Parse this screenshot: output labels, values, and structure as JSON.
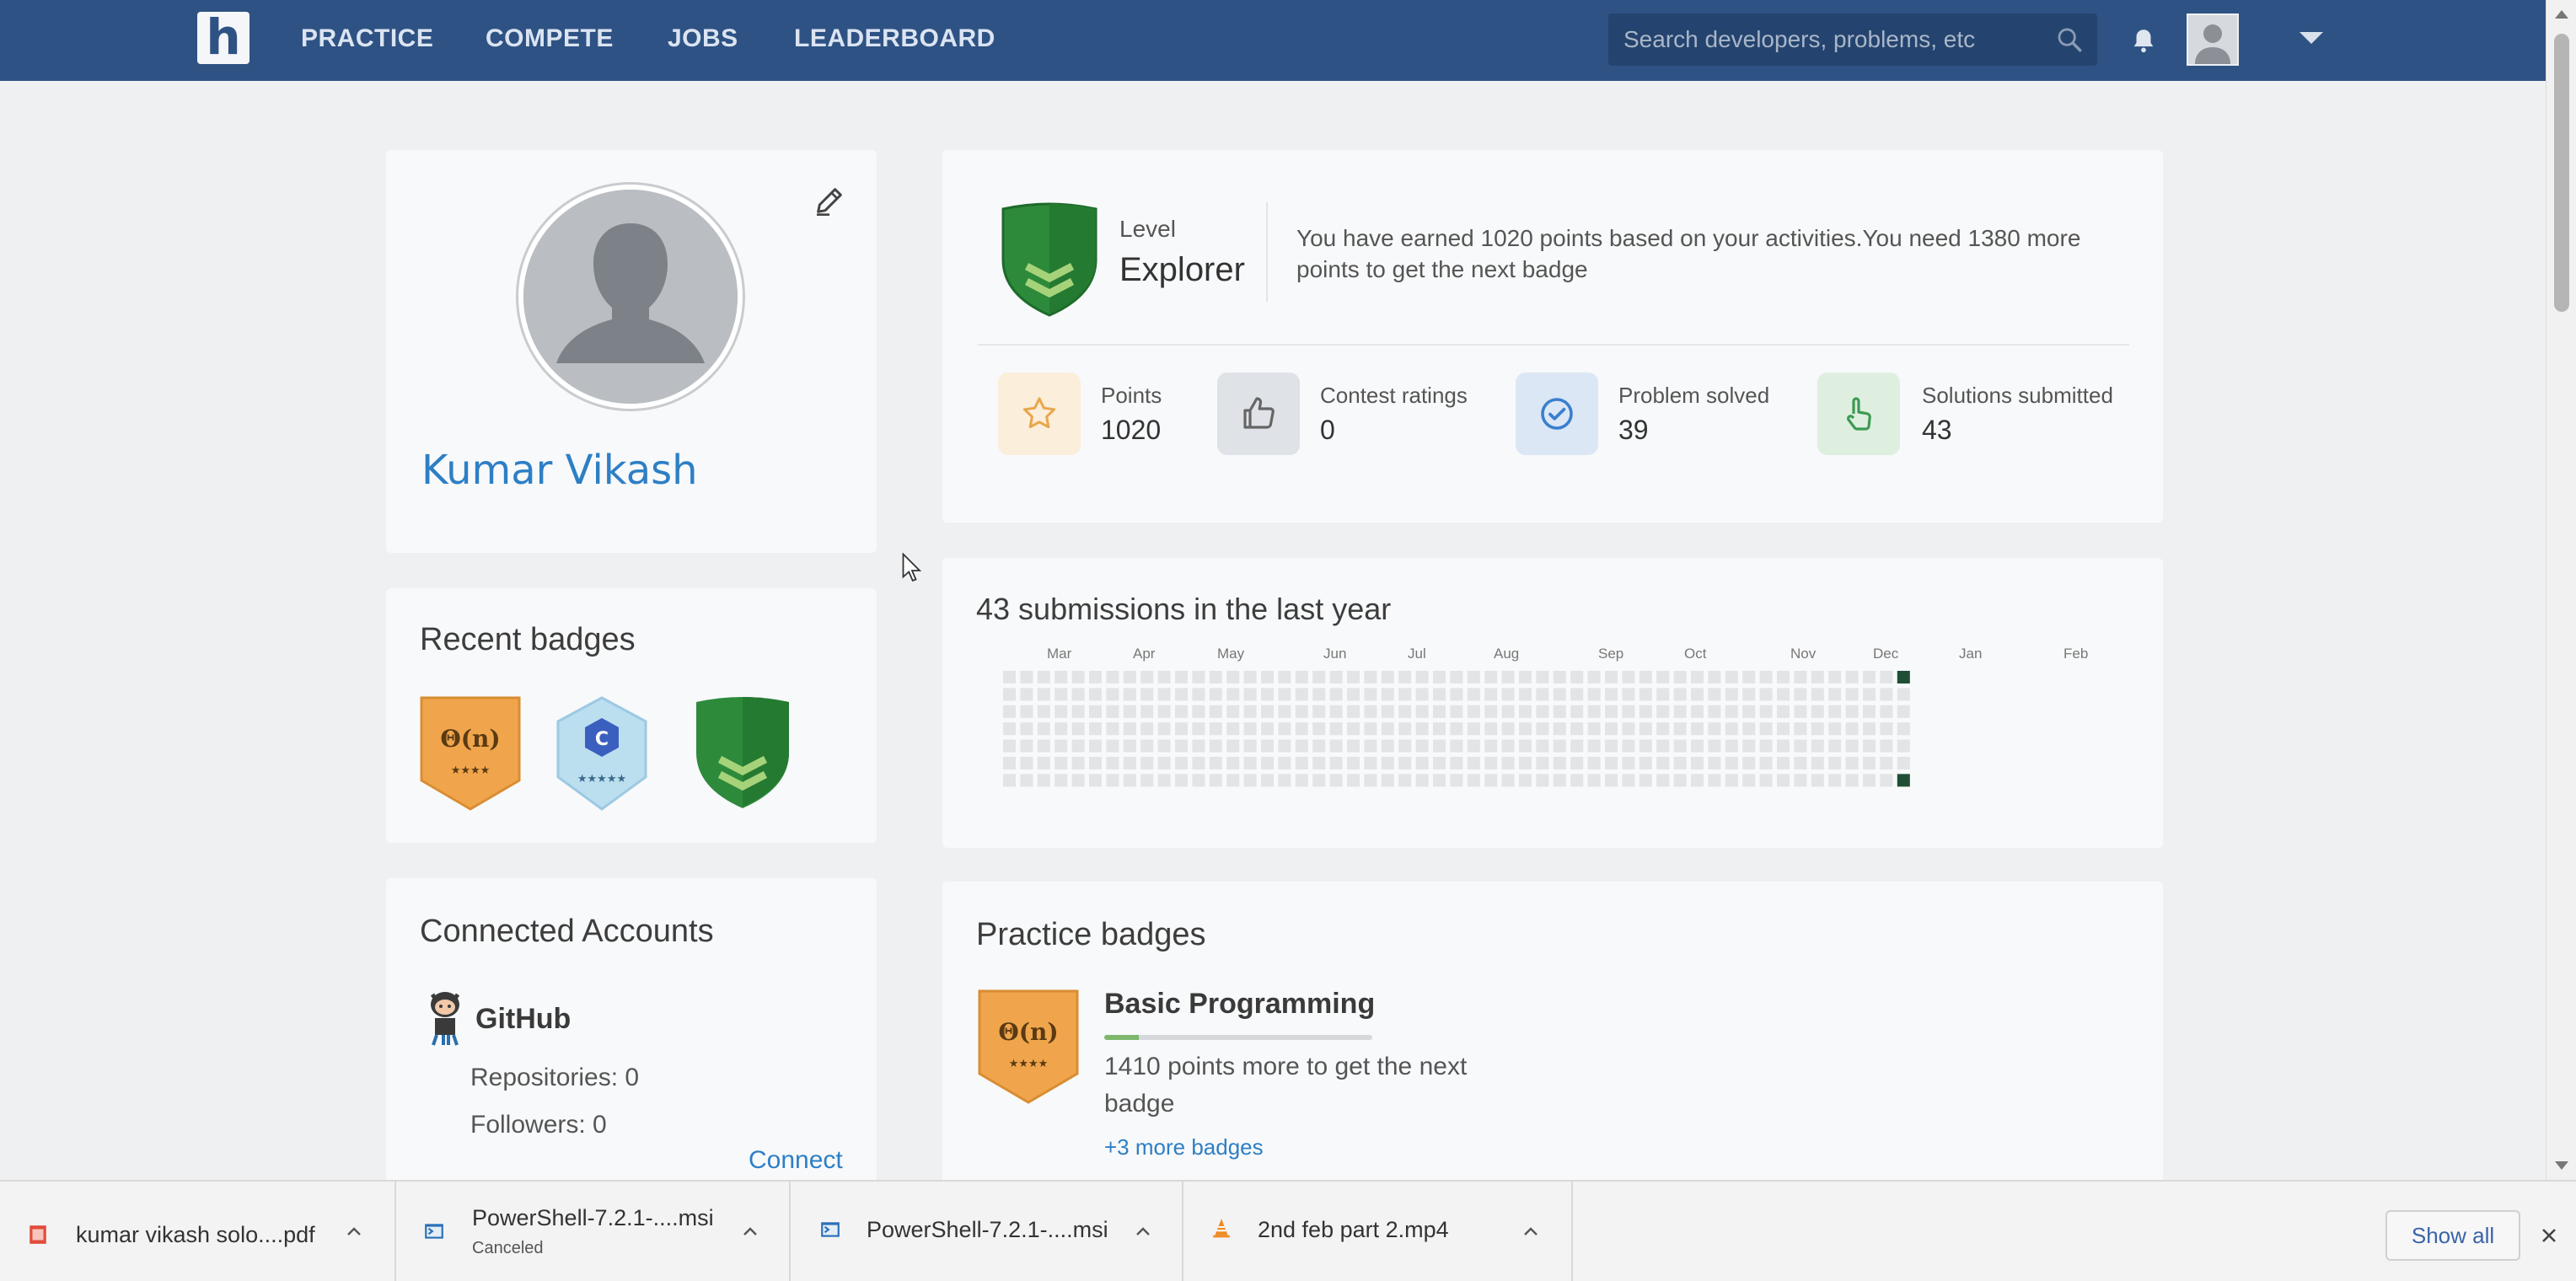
{
  "nav": {
    "logo": "h",
    "links": [
      "PRACTICE",
      "COMPETE",
      "JOBS",
      "LEADERBOARD"
    ],
    "search_placeholder": "Search developers, problems, etc"
  },
  "profile": {
    "name": "Kumar Vikash"
  },
  "level": {
    "label": "Level",
    "value": "Explorer",
    "message": "You have earned 1020 points based on your activities.You need 1380 more points to get the next badge"
  },
  "stats": [
    {
      "label": "Points",
      "value": "1020",
      "icon": "star-icon",
      "color": "#fbeedb"
    },
    {
      "label": "Contest ratings",
      "value": "0",
      "icon": "thumbs-up-icon",
      "color": "#dfe2e6"
    },
    {
      "label": "Problem solved",
      "value": "39",
      "icon": "check-circle-icon",
      "color": "#dbe7f4"
    },
    {
      "label": "Solutions submitted",
      "value": "43",
      "icon": "pointer-hand-icon",
      "color": "#deefe0"
    }
  ],
  "recent_badges": {
    "title": "Recent badges",
    "items": [
      {
        "name": "complexity-badge",
        "text": "Θ(n)",
        "color": "#f0a54c"
      },
      {
        "name": "c-language-badge",
        "text": "C",
        "color": "#bcdff0"
      },
      {
        "name": "explorer-shield-badge",
        "text": "",
        "color": "#2f8a3c"
      }
    ]
  },
  "submissions": {
    "title": "43 submissions in the last year",
    "months": [
      "Mar",
      "Apr",
      "May",
      "Jun",
      "Jul",
      "Aug",
      "Sep",
      "Oct",
      "Nov",
      "Dec",
      "Jan",
      "Feb"
    ]
  },
  "connected": {
    "title": "Connected Accounts",
    "service": "GitHub",
    "repositories": "Repositories: 0",
    "followers": "Followers: 0",
    "connect": "Connect"
  },
  "practice": {
    "title": "Practice badges",
    "badge_text": "Θ(n)",
    "badge_name": "Basic Programming",
    "progress": 0.13,
    "message": "1410 points more to get the next badge",
    "more": "+3 more badges"
  },
  "downloads": {
    "items": [
      {
        "name": "kumar vikash solo....pdf",
        "status": "",
        "icon": "pdf-file-icon"
      },
      {
        "name": "PowerShell-7.2.1-....msi",
        "status": "Canceled",
        "icon": "installer-file-icon"
      },
      {
        "name": "PowerShell-7.2.1-....msi",
        "status": "",
        "icon": "installer-file-icon"
      },
      {
        "name": "2nd feb part 2.mp4",
        "status": "",
        "icon": "vlc-cone-icon"
      }
    ],
    "show_all": "Show all"
  },
  "colors": {
    "nav_bg": "#2e5283",
    "link": "#2d7fc5",
    "heatmap_empty": "#e3e4e6",
    "heatmap_active": "#1f4d36"
  }
}
